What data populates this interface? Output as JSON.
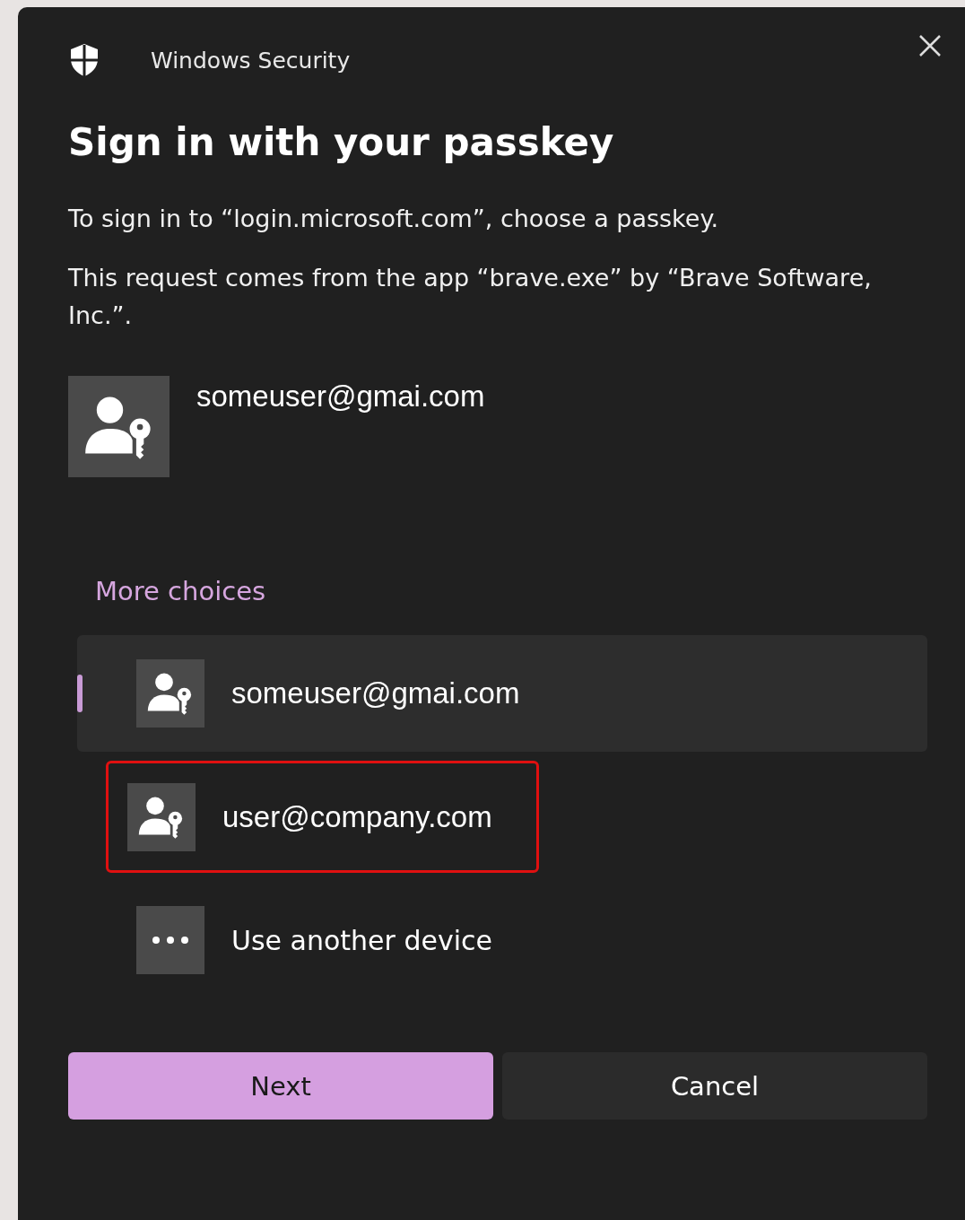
{
  "window": {
    "title": "Windows Security"
  },
  "heading": "Sign in with your passkey",
  "messages": [
    "To sign in to “login.microsoft.com”, choose a passkey.",
    "This request comes from the app “brave.exe” by “Brave Software, Inc.”."
  ],
  "account": {
    "email": "someuser@gmai.com"
  },
  "more_choices": "More choices",
  "options": [
    {
      "kind": "passkey",
      "label": "someuser@gmai.com",
      "selected": true,
      "highlighted": false
    },
    {
      "kind": "passkey",
      "label": "user@company.com",
      "selected": false,
      "highlighted": true
    },
    {
      "kind": "device",
      "label": "Use another device",
      "selected": false,
      "highlighted": false
    }
  ],
  "buttons": [
    {
      "label": "Next",
      "kind": "primary"
    },
    {
      "label": "Cancel",
      "kind": "secondary"
    }
  ]
}
